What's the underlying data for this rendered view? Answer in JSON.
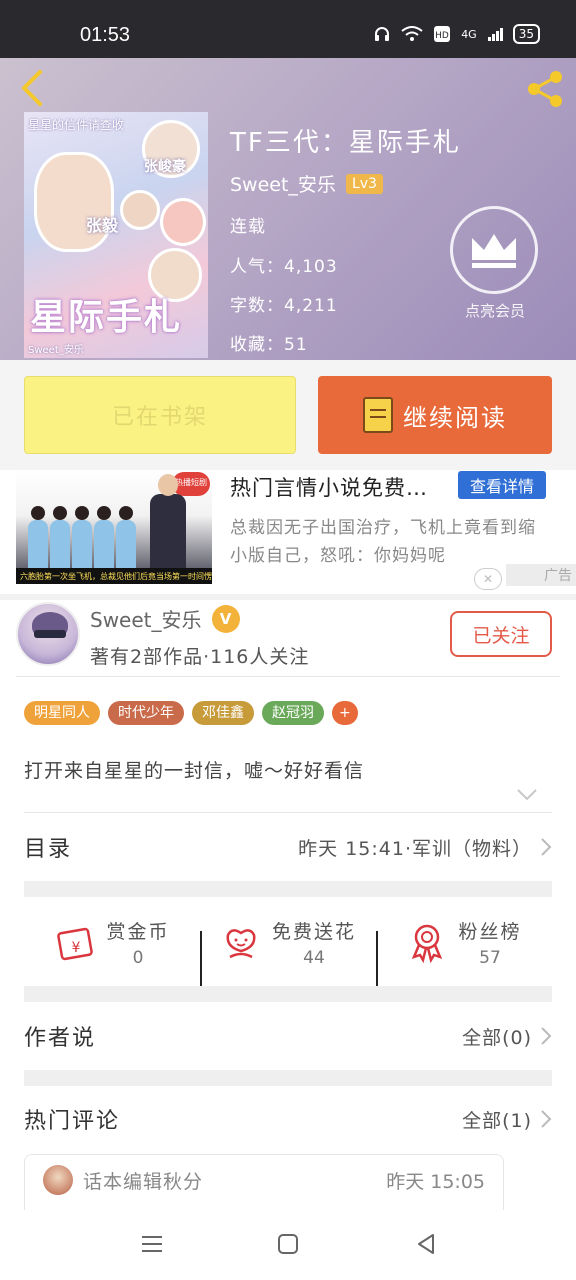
{
  "status_bar": {
    "time": "01:53",
    "battery": "35",
    "network": "4G"
  },
  "book": {
    "title": "TF三代：星际手札",
    "author": "Sweet_安乐",
    "level": "Lv3",
    "status": "连载",
    "popularity": "人气：4,103",
    "word_count": "字数：4,211",
    "favorites": "收藏：51",
    "cover_art_text": "星际手札",
    "cover_top_text": "星星的信件请查收",
    "cover_names": [
      "张峻豪",
      "张毅"
    ],
    "cover_watermark": "Sweet_安乐"
  },
  "vip": {
    "label": "点亮会员",
    "icon": "crown-icon"
  },
  "actions": {
    "shelf_label": "已在书架",
    "read_label": "继续阅读"
  },
  "ad": {
    "title": "热门言情小说免费…",
    "detail_label": "查看详情",
    "description": "总裁因无子出国治疗，飞机上竟看到缩小版自己，怒吼：你妈妈呢",
    "img_tag": "热播短剧",
    "img_caption": "六胞胎第一次坐飞机，总裁见他们后竟当场第一时间愣住了",
    "ad_mark": "广告",
    "close_label": "✕"
  },
  "author_card": {
    "name": "Sweet_安乐",
    "badge": "V",
    "stats": "著有2部作品·116人关注",
    "follow_label": "已关注"
  },
  "tags": [
    {
      "label": "明星同人",
      "color": "#f0a23a"
    },
    {
      "label": "时代少年",
      "color": "#c96a4a"
    },
    {
      "label": "邓佳鑫",
      "color": "#c79a3a"
    },
    {
      "label": "赵冠羽",
      "color": "#6aa85a"
    },
    {
      "label": "+",
      "color": "#e86a3a"
    }
  ],
  "summary": "打开来自星星的一封信，嘘～好好看信",
  "catalog": {
    "label": "目录",
    "latest": "昨天 15:41·军训（物料）"
  },
  "stats": [
    {
      "icon": "red-envelope-icon",
      "label": "赏金币",
      "value": "0"
    },
    {
      "icon": "flower-icon",
      "label": "免费送花",
      "value": "44"
    },
    {
      "icon": "medal-icon",
      "label": "粉丝榜",
      "value": "57"
    }
  ],
  "author_says": {
    "label": "作者说",
    "count": "全部(0)"
  },
  "hot_comments": {
    "label": "热门评论",
    "count": "全部(1)",
    "first_comment": {
      "user": "话本编辑秋分",
      "time": "昨天 15:05"
    }
  },
  "colors": {
    "accent_orange": "#e86a3a",
    "shelf_yellow": "#fbf284",
    "follow_red": "#e35b48",
    "ad_blue": "#2f6fd6"
  }
}
